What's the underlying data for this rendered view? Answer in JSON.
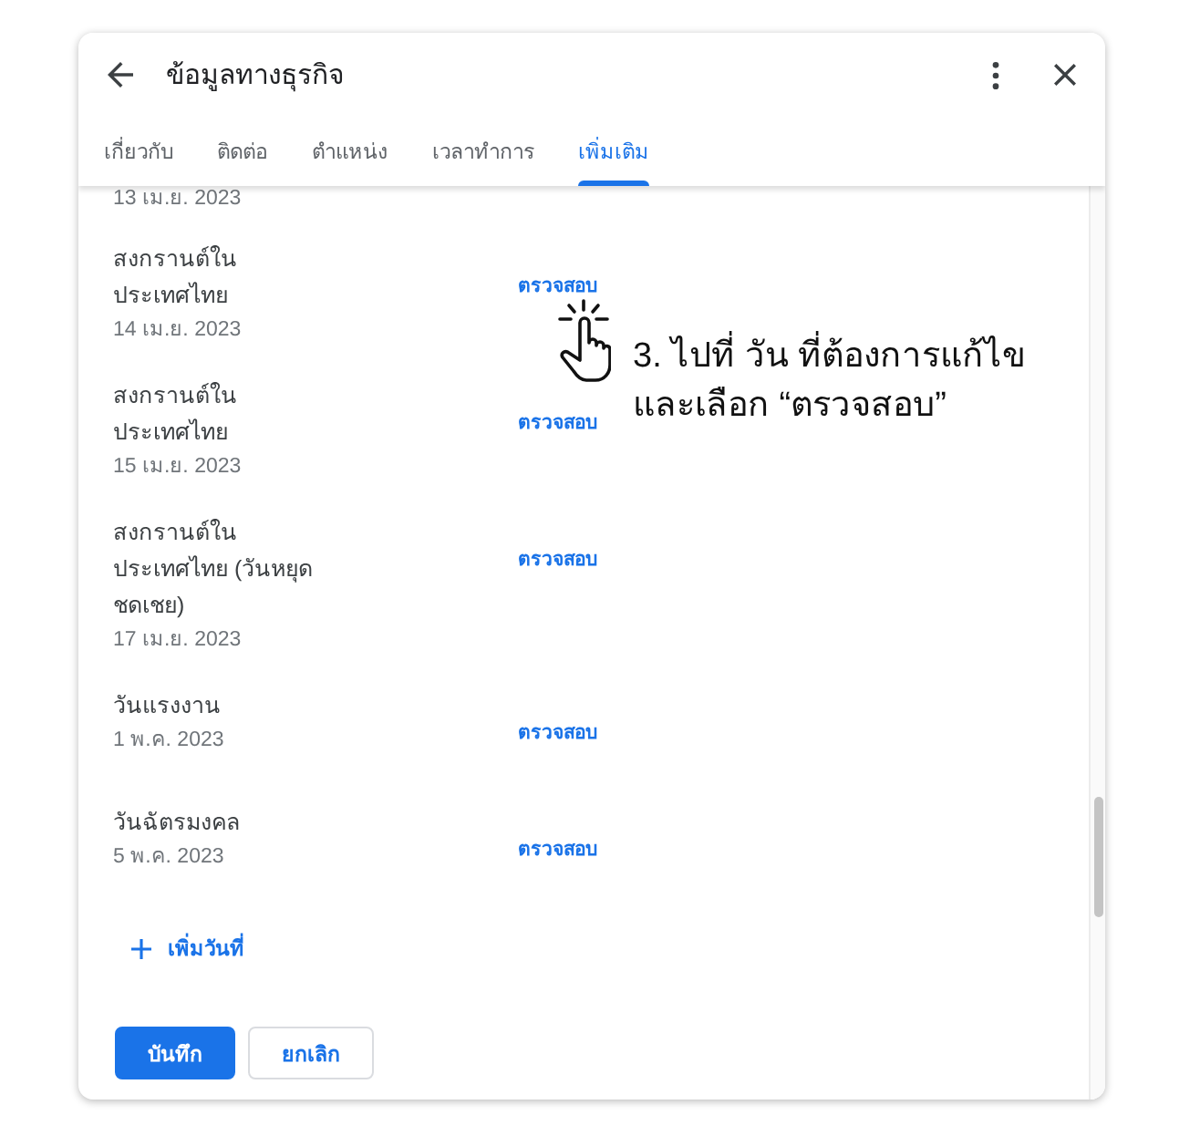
{
  "dialog": {
    "title": "ข้อมูลทางธุรกิจ"
  },
  "tabs": [
    {
      "label": "เกี่ยวกับ",
      "selected": false
    },
    {
      "label": "ติดต่อ",
      "selected": false
    },
    {
      "label": "ตำแหน่ง",
      "selected": false
    },
    {
      "label": "เวลาทำการ",
      "selected": false
    },
    {
      "label": "เพิ่มเติม",
      "selected": true
    }
  ],
  "holidays": [
    {
      "date": "13 เม.ย. 2023"
    },
    {
      "name": "สงกรานต์ใน\nประเทศไทย",
      "date": "14 เม.ย. 2023",
      "action": "ตรวจสอบ"
    },
    {
      "name": "สงกรานต์ใน\nประเทศไทย",
      "date": "15 เม.ย. 2023",
      "action": "ตรวจสอบ"
    },
    {
      "name": "สงกรานต์ใน\nประเทศไทย (วันหยุด\nชดเชย)",
      "date": "17 เม.ย. 2023",
      "action": "ตรวจสอบ"
    },
    {
      "name": "วันแรงงาน",
      "date": "1 พ.ค. 2023",
      "action": "ตรวจสอบ"
    },
    {
      "name": "วันฉัตรมงคล",
      "date": "5 พ.ค. 2023",
      "action": "ตรวจสอบ"
    }
  ],
  "add_date": {
    "label": "เพิ่มวันที่"
  },
  "buttons": [
    {
      "label": "บันทึก",
      "kind": "primary"
    },
    {
      "label": "ยกเลิก",
      "kind": "secondary"
    }
  ],
  "annotation": {
    "text": "3. ไปที่ วัน ที่ต้องการแก้ไข\nและเลือก “ตรวจสอบ”"
  }
}
